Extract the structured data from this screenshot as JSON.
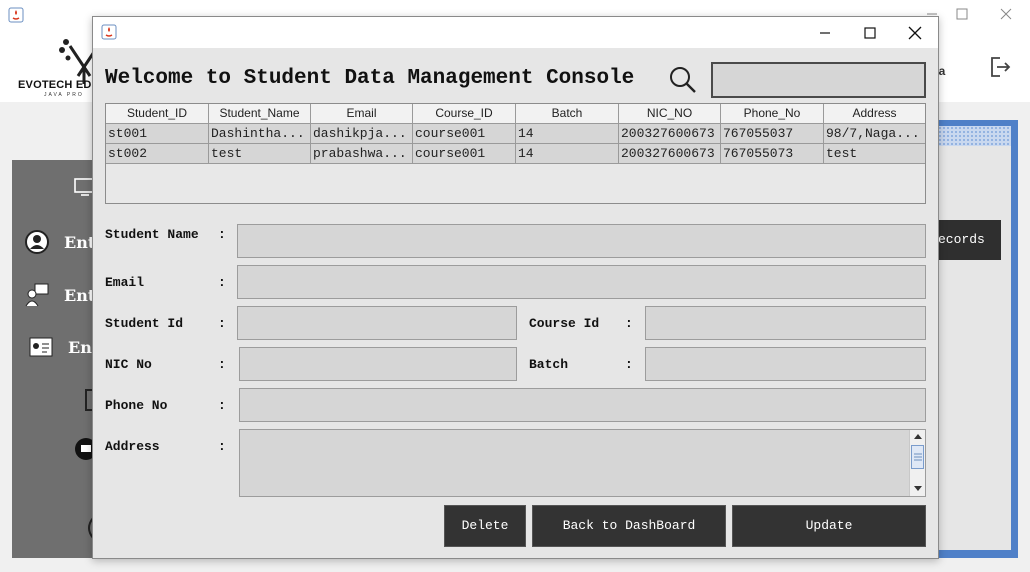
{
  "background_window": {
    "logo_text": "EVOTECH EDU",
    "logo_subtext": "JAVA PRO",
    "username": "ntha",
    "sidebar_items": [
      {
        "label": "Ent",
        "icon": "user-circle-icon"
      },
      {
        "label": "Ent",
        "icon": "teacher-icon"
      },
      {
        "label": "En",
        "icon": "id-card-icon"
      }
    ],
    "records_button_label": "ecords"
  },
  "dialog": {
    "title": "Welcome to Student Data Management Console",
    "search": {
      "value": "",
      "placeholder": ""
    }
  },
  "table": {
    "columns": [
      "Student_ID",
      "Student_Name",
      "Email",
      "Course_ID",
      "Batch",
      "NIC_NO",
      "Phone_No",
      "Address"
    ],
    "rows": [
      [
        "st001",
        "Dashintha...",
        "dashikpja...",
        "course001",
        "14",
        "200327600673",
        "767055037",
        "98/7,Naga..."
      ],
      [
        "st002",
        "test",
        "prabashwa...",
        "course001",
        "14",
        "200327600673",
        "767055073",
        "test"
      ]
    ]
  },
  "form": {
    "student_name_label": "Student Name",
    "email_label": "Email",
    "student_id_label": "Student Id",
    "course_id_label": "Course Id",
    "nic_label": "NIC No",
    "batch_label": "Batch",
    "phone_label": "Phone No",
    "address_label": "Address",
    "colon": ":",
    "values": {
      "student_name": "",
      "email": "",
      "student_id": "",
      "course_id": "",
      "nic": "",
      "batch": "",
      "phone": "",
      "address": ""
    }
  },
  "buttons": {
    "delete": "Delete",
    "back": "Back to DashBoard",
    "update": "Update"
  },
  "colors": {
    "dialog_bg": "#e6e6e6",
    "field_bg": "#d6d6d6",
    "button_bg": "#333333",
    "panel_accent": "#4f80c8"
  }
}
